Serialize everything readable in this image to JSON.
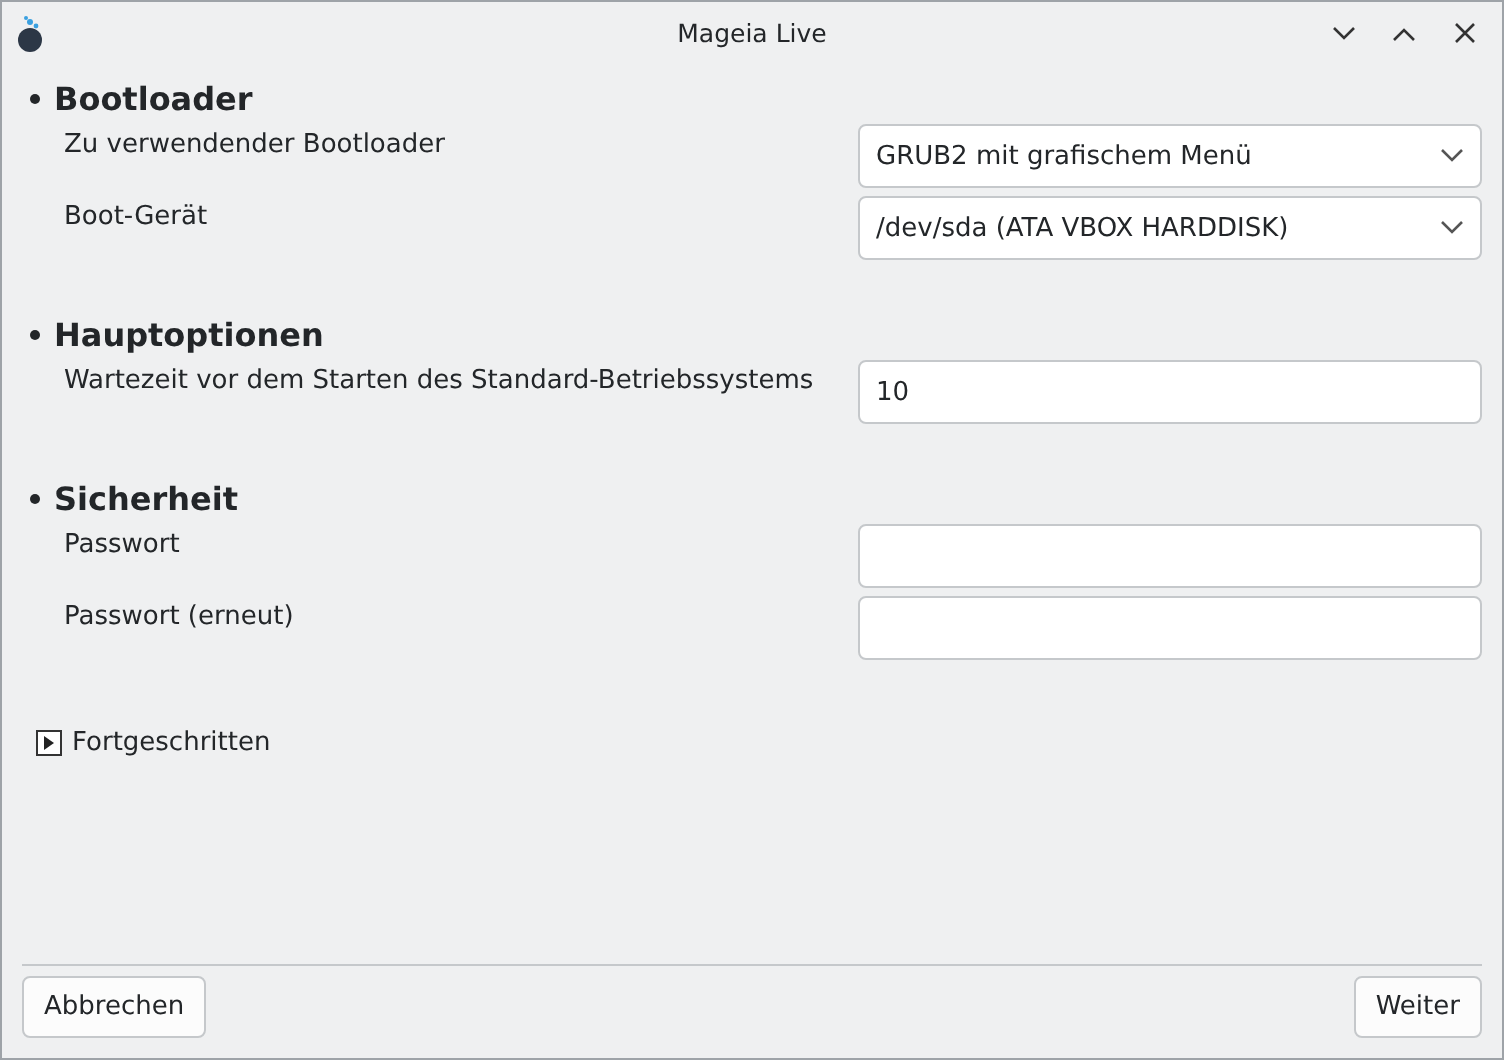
{
  "window": {
    "title": "Mageia Live"
  },
  "sections": [
    {
      "title": "Bootloader",
      "rows": [
        {
          "kind": "select",
          "label": "Zu verwendender Bootloader",
          "value": "GRUB2 mit grafischem Menü"
        },
        {
          "kind": "select",
          "label": "Boot-Gerät",
          "value": "/dev/sda (ATA VBOX HARDDISK)"
        }
      ]
    },
    {
      "title": "Hauptoptionen",
      "rows": [
        {
          "kind": "input",
          "label": "Wartezeit vor dem Starten des Standard-Betriebssystems",
          "value": "10"
        }
      ]
    },
    {
      "title": "Sicherheit",
      "rows": [
        {
          "kind": "input",
          "label": "Passwort",
          "value": ""
        },
        {
          "kind": "input",
          "label": "Passwort (erneut)",
          "value": ""
        }
      ]
    }
  ],
  "advanced": {
    "label": "Fortgeschritten",
    "expanded": false
  },
  "buttons": {
    "left": "Abbrechen",
    "right": "Weiter"
  }
}
